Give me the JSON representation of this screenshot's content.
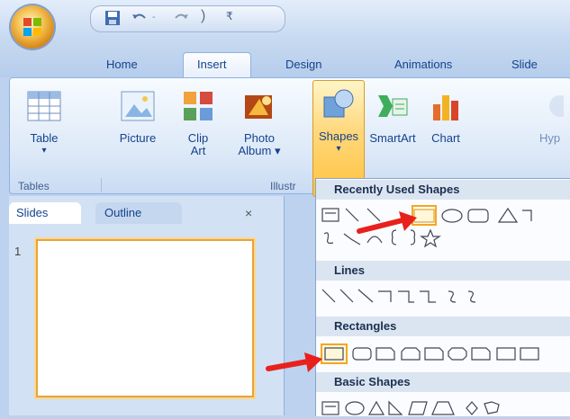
{
  "tabs": [
    "Home",
    "Insert",
    "Design",
    "Animations",
    "Slide"
  ],
  "ribbon": {
    "buttons": [
      {
        "label": "Table",
        "sub": "▾"
      },
      {
        "label": "Picture"
      },
      {
        "label": "Clip",
        "sub": "Art"
      },
      {
        "label": "Photo",
        "sub": "Album ▾"
      },
      {
        "label": "Shapes",
        "sub": "▾"
      },
      {
        "label": "SmartArt"
      },
      {
        "label": "Chart"
      },
      {
        "label": "Hyp"
      }
    ],
    "groups": [
      "Tables",
      "Illustr"
    ]
  },
  "pane": {
    "tab_slides": "Slides",
    "tab_outline": "Outline",
    "close": "×",
    "slide_number": "1"
  },
  "gallery": {
    "recent": "Recently Used Shapes",
    "lines": "Lines",
    "rectangles": "Rectangles",
    "basic": "Basic Shapes"
  },
  "colors": {
    "accent_arrow": "#e8211c",
    "highlight": "#f5a623",
    "ribbon_text": "#15428b"
  }
}
